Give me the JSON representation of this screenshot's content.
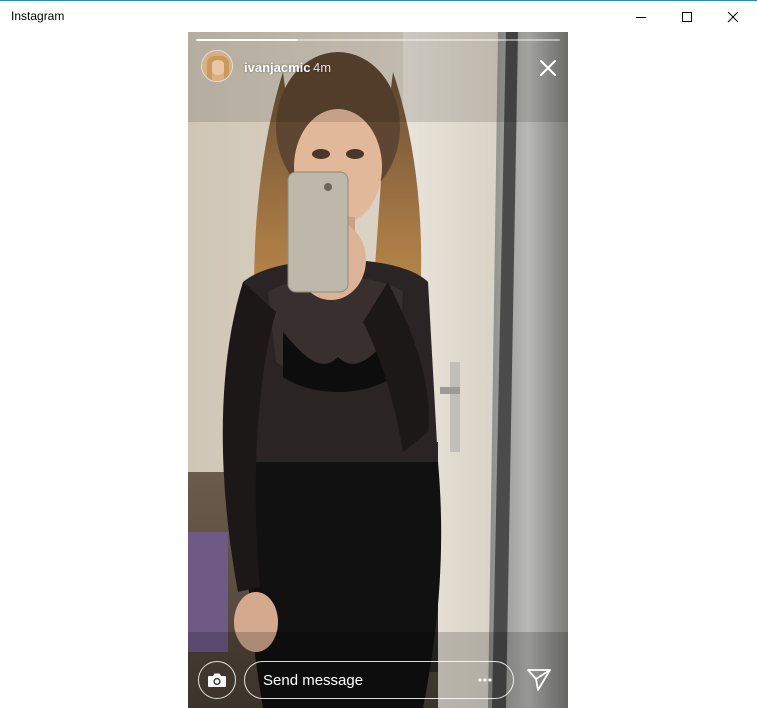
{
  "window": {
    "title": "Instagram"
  },
  "story": {
    "username": "ivanjacmic",
    "time_ago": "4m",
    "progress": 0.28
  },
  "composer": {
    "placeholder": "Send message"
  },
  "icons": {
    "minimize": "minimize-icon",
    "maximize": "maximize-icon",
    "close": "close-icon",
    "story_close": "close-icon",
    "camera": "camera-icon",
    "more": "ellipsis-icon",
    "send": "paper-plane-icon"
  },
  "colors": {
    "titlebar_accent": "#2b88d8",
    "overlay_text": "#ffffff"
  }
}
